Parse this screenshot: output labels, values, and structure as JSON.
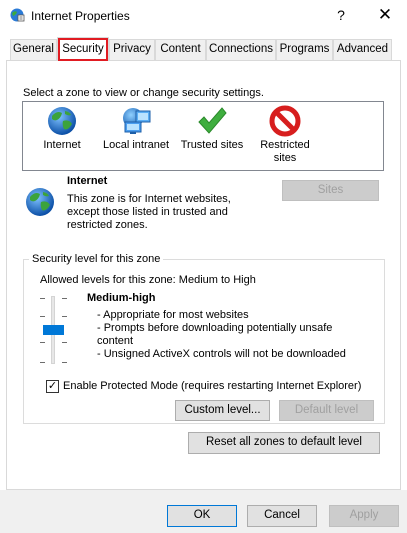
{
  "window": {
    "title": "Internet Properties",
    "help": "?",
    "close": "✕"
  },
  "tabs": [
    {
      "label": "General",
      "active": false
    },
    {
      "label": "Security",
      "active": true
    },
    {
      "label": "Privacy",
      "active": false
    },
    {
      "label": "Content",
      "active": false
    },
    {
      "label": "Connections",
      "active": false
    },
    {
      "label": "Programs",
      "active": false
    },
    {
      "label": "Advanced",
      "active": false
    }
  ],
  "security": {
    "zone_prompt": "Select a zone to view or change security settings.",
    "zones": [
      {
        "label_line1": "Internet",
        "label_line2": "",
        "icon": "globe-icon"
      },
      {
        "label_line1": "Local intranet",
        "label_line2": "",
        "icon": "intranet-globe-icon"
      },
      {
        "label_line1": "Trusted sites",
        "label_line2": "",
        "icon": "checkmark-icon"
      },
      {
        "label_line1": "Restricted",
        "label_line2": "sites",
        "icon": "no-entry-icon"
      }
    ],
    "selected_zone": {
      "name": "Internet",
      "desc_line1": "This zone is for Internet websites,",
      "desc_line2": "except those listed in trusted and",
      "desc_line3": "restricted zones."
    },
    "sites_button": "Sites",
    "level_group_title": "Security level for this zone",
    "allowed_levels": "Allowed levels for this zone: Medium to High",
    "level_name": "Medium-high",
    "level_details": [
      "- Appropriate for most websites",
      "- Prompts before downloading potentially unsafe",
      "content",
      "- Unsigned ActiveX controls will not be downloaded"
    ],
    "slider_level": "Medium-high",
    "protected_mode_label": "Enable Protected Mode (requires restarting Internet Explorer)",
    "protected_mode_checked": true,
    "protected_mode_mark": "✓",
    "custom_level_button": "Custom level...",
    "default_level_button": "Default level",
    "reset_all_button": "Reset all zones to default level"
  },
  "footer": {
    "ok": "OK",
    "cancel": "Cancel",
    "apply": "Apply"
  },
  "colors": {
    "accent": "#0078d7",
    "tab_highlight": "#e11b22",
    "dialog_bg": "#f0f0f0"
  }
}
